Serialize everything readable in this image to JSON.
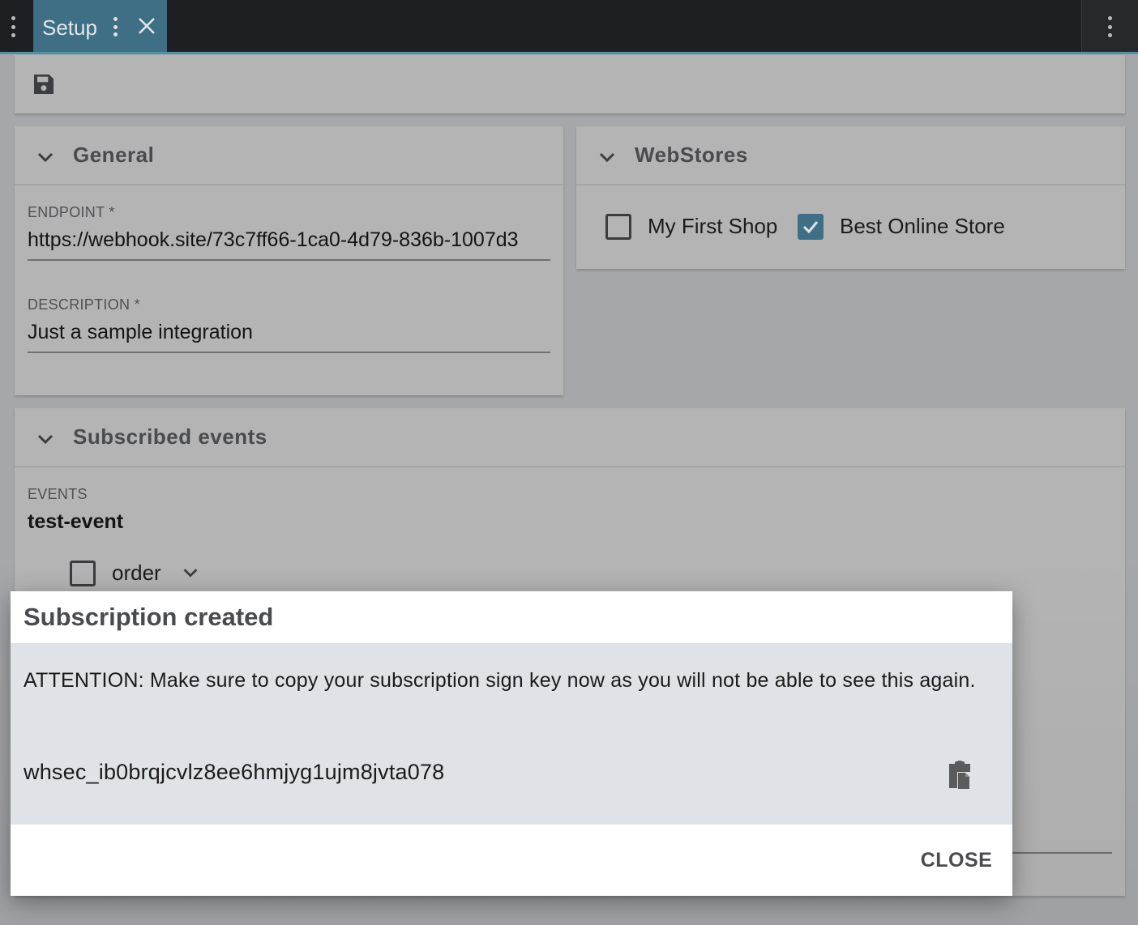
{
  "tabbar": {
    "tab_label": "Setup"
  },
  "general": {
    "title": "General",
    "endpoint_label": "ENDPOINT *",
    "endpoint_value": "https://webhook.site/73c7ff66-1ca0-4d79-836b-1007d3",
    "description_label": "DESCRIPTION *",
    "description_value": "Just a sample integration"
  },
  "webstores": {
    "title": "WebStores",
    "stores": [
      {
        "label": "My First Shop",
        "checked": false
      },
      {
        "label": "Best Online Store",
        "checked": true
      }
    ]
  },
  "subscribed": {
    "title": "Subscribed events",
    "events_label": "EVENTS",
    "events_value": "test-event",
    "group_label": "order"
  },
  "dialog": {
    "title": "Subscription created",
    "message": "ATTENTION: Make sure to copy your subscription sign key now as you will not be able to see this again.",
    "sign_key": "whsec_ib0brqjcvlz8ee6hmjyg1ujm8jvta078",
    "close_label": "CLOSE"
  },
  "colors": {
    "accent": "#3e6f84",
    "topbar": "#1e1f23",
    "card": "#b4b4b4"
  }
}
